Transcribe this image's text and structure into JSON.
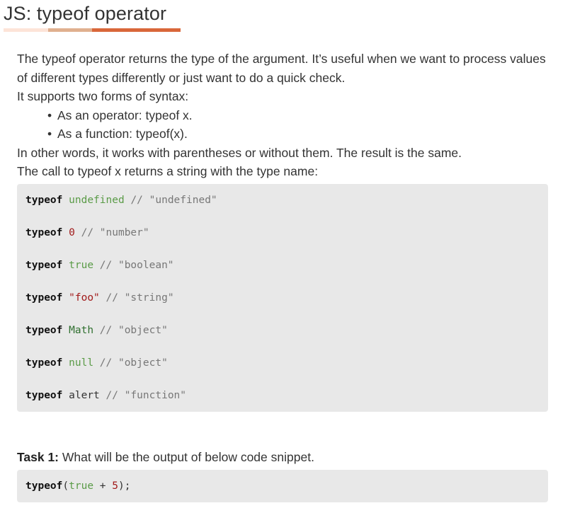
{
  "title": "JS: typeof operator",
  "accent_colors": [
    "#fde4d8",
    "#e0b08f",
    "#d9673a"
  ],
  "intro": {
    "p1": "The typeof operator returns the type of the argument. It’s useful when we want to process values of different types differently or just want to do a quick check.",
    "p2": "It supports two forms of syntax:",
    "bullets": [
      "As an operator: typeof x.",
      "As a function: typeof(x)."
    ],
    "p3": "In other words, it works with parentheses or without them. The result is the same.",
    "p4": "The call to typeof x returns a string with the type name:"
  },
  "code_lines": [
    {
      "kw": "typeof",
      "val": "undefined",
      "cls": "lit",
      "comment": "// \"undefined\""
    },
    {
      "kw": "typeof",
      "val": "0",
      "cls": "num",
      "comment": "// \"number\""
    },
    {
      "kw": "typeof",
      "val": "true",
      "cls": "lit",
      "comment": "// \"boolean\""
    },
    {
      "kw": "typeof",
      "val": "\"foo\"",
      "cls": "str",
      "comment": "// \"string\""
    },
    {
      "kw": "typeof",
      "val": "Math",
      "cls": "cls",
      "comment": "// \"object\""
    },
    {
      "kw": "typeof",
      "val": "null",
      "cls": "lit",
      "comment": "// \"object\""
    },
    {
      "kw": "typeof",
      "val": "alert",
      "cls": "plain",
      "comment": "// \"function\""
    }
  ],
  "task": {
    "label": "Task 1:",
    "text": " What will be the output of below code snippet.",
    "code": {
      "kw": "typeof",
      "open": "(",
      "lit": "true",
      "op": " + ",
      "num": "5",
      "close": ");"
    }
  }
}
